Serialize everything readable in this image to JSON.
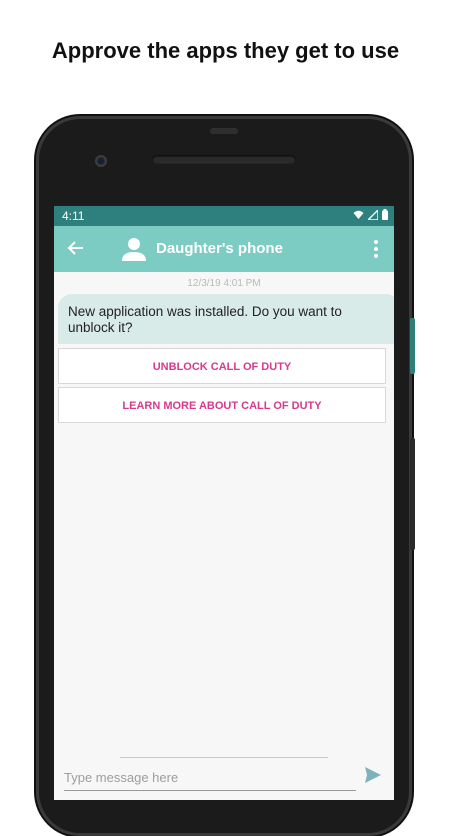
{
  "headline": "Approve the apps they get to use",
  "status_bar": {
    "time": "4:11",
    "icons": [
      "wifi-icon",
      "signal-icon",
      "battery-icon"
    ]
  },
  "toolbar": {
    "contact_name": "Daughter's phone",
    "icons": [
      "back-arrow-icon",
      "person-icon",
      "more-vert-icon"
    ]
  },
  "chat": {
    "timestamp": "12/3/19 4:01 PM",
    "message": "New application was installed. Do you want to unblock it?",
    "actions": [
      {
        "label": "UNBLOCK CALL OF DUTY"
      },
      {
        "label": "LEARN MORE ABOUT CALL OF DUTY"
      }
    ]
  },
  "composer": {
    "placeholder": "Type message here",
    "value": "",
    "send_icon": "send-icon"
  },
  "colors": {
    "status_bar": "#2d807e",
    "toolbar": "#7cccc3",
    "bubble": "#d8ebe9",
    "action_text": "#d63a8f",
    "send_icon": "#7fb1bb"
  }
}
